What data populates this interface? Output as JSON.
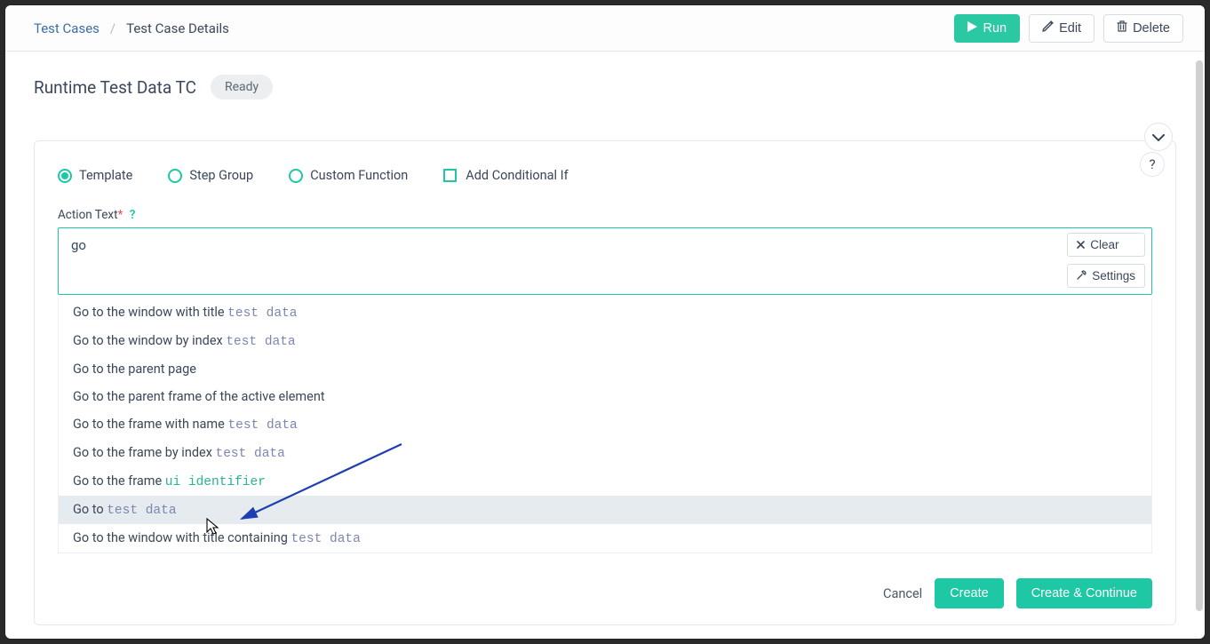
{
  "breadcrumb": {
    "root": "Test Cases",
    "current": "Test Case Details"
  },
  "top_actions": {
    "run": "Run",
    "edit": "Edit",
    "delete": "Delete"
  },
  "page": {
    "title": "Runtime Test Data TC",
    "status": "Ready"
  },
  "step_types": {
    "template": "Template",
    "step_group": "Step Group",
    "custom_function": "Custom Function",
    "add_conditional_if": "Add Conditional If"
  },
  "field": {
    "label": "Action Text",
    "value": "go",
    "clear": "Clear",
    "settings": "Settings"
  },
  "suggestions": [
    {
      "prefix": "Go to the window with title ",
      "param": "test data",
      "param_type": "td"
    },
    {
      "prefix": "Go to the window by index ",
      "param": "test data",
      "param_type": "td"
    },
    {
      "prefix": "Go to the parent page",
      "param": "",
      "param_type": "none"
    },
    {
      "prefix": "Go to the parent frame of the active element",
      "param": "",
      "param_type": "none"
    },
    {
      "prefix": "Go to the frame with name ",
      "param": "test data",
      "param_type": "td"
    },
    {
      "prefix": "Go to the frame by index ",
      "param": "test data",
      "param_type": "td"
    },
    {
      "prefix": "Go to the frame ",
      "param": "ui identifier",
      "param_type": "ui"
    },
    {
      "prefix": "Go to ",
      "param": "test data",
      "param_type": "td",
      "hover": true
    },
    {
      "prefix": "Go to the window with title containing ",
      "param": "test data",
      "param_type": "td"
    }
  ],
  "footer": {
    "cancel": "Cancel",
    "create": "Create",
    "create_continue": "Create & Continue"
  }
}
